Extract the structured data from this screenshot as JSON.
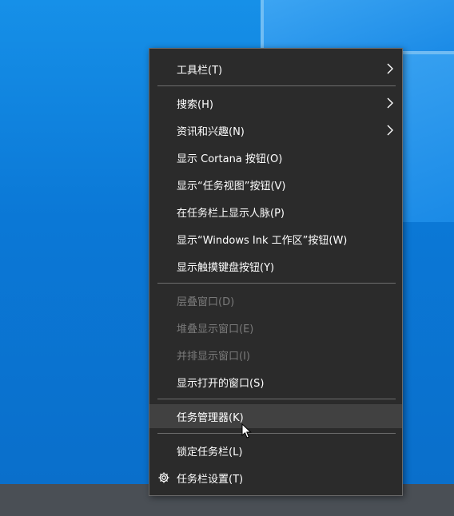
{
  "desktop": {
    "accent": "#0b78d6",
    "taskbar_color": "#4a4f55"
  },
  "menu": {
    "items": [
      {
        "label": "工具栏(T)",
        "submenu": true
      },
      {
        "label": "搜索(H)",
        "submenu": true
      },
      {
        "label": "资讯和兴趣(N)",
        "submenu": true
      },
      {
        "label": "显示 Cortana 按钮(O)"
      },
      {
        "label": "显示“任务视图”按钮(V)"
      },
      {
        "label": "在任务栏上显示人脉(P)"
      },
      {
        "label": "显示“Windows Ink 工作区”按钮(W)"
      },
      {
        "label": "显示触摸键盘按钮(Y)"
      },
      {
        "label": "层叠窗口(D)",
        "disabled": true
      },
      {
        "label": "堆叠显示窗口(E)",
        "disabled": true
      },
      {
        "label": "并排显示窗口(I)",
        "disabled": true
      },
      {
        "label": "显示打开的窗口(S)"
      },
      {
        "label": "任务管理器(K)",
        "highlighted": true
      },
      {
        "label": "锁定任务栏(L)"
      },
      {
        "label": "任务栏设置(T)",
        "icon": "gear-icon"
      }
    ]
  }
}
